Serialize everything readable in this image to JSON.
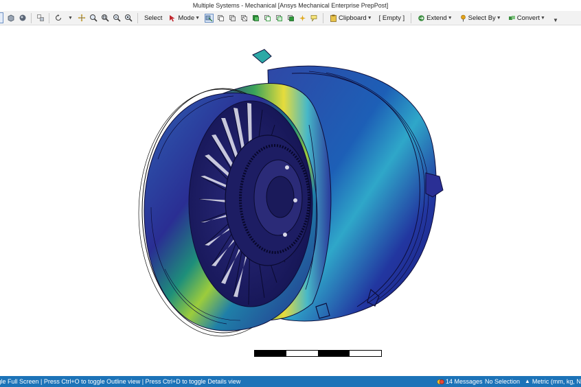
{
  "window": {
    "title": "Multiple Systems - Mechanical [Ansys Mechanical Enterprise PrepPost]"
  },
  "toolbar": {
    "select_label": "Select",
    "mode_label": "Mode",
    "clipboard_label": "Clipboard",
    "empty_label": "[ Empty ]",
    "extend_label": "Extend",
    "select_by_label": "Select By",
    "convert_label": "Convert"
  },
  "statusbar": {
    "hint_text": "toggle Full Screen | Press Ctrl+O to toggle Outline view | Press Ctrl+D to toggle Details view",
    "messages_text": "14 Messages",
    "selection_text": "No Selection",
    "units_text": "Metric (mm, kg, N,"
  },
  "colors": {
    "statusbar_bg": "#1c73b8",
    "contour_low": "#2a1f8f",
    "contour_mid": "#1fa0a0",
    "contour_high": "#e8e03a"
  }
}
